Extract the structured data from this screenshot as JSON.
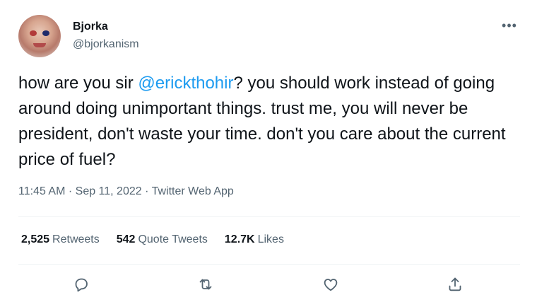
{
  "author": {
    "name": "Bjorka",
    "handle": "@bjorkanism"
  },
  "menu": {
    "icon": "more-dots-icon",
    "glyph": "•••"
  },
  "tweet": {
    "text_before": "how are you sir ",
    "mention": "@erickthohir",
    "text_after": "? you should work instead of going around doing unimportant things. trust me, you will never be president, don't waste your time. don't you care about the current price of fuel?",
    "time": "11:45 AM",
    "separator": " · ",
    "date": "Sep 11, 2022",
    "source": "Twitter Web App"
  },
  "stats": {
    "retweets_count": "2,525",
    "retweets_label": "Retweets",
    "quotes_count": "542",
    "quotes_label": "Quote Tweets",
    "likes_count": "12.7K",
    "likes_label": "Likes"
  },
  "actions": [
    {
      "icon": "reply-icon"
    },
    {
      "icon": "retweet-icon"
    },
    {
      "icon": "like-icon"
    },
    {
      "icon": "share-icon"
    }
  ],
  "colors": {
    "link": "#1d9bf0",
    "secondary_text": "#536471",
    "primary_text": "#0f1419",
    "divider": "#eff3f4"
  }
}
